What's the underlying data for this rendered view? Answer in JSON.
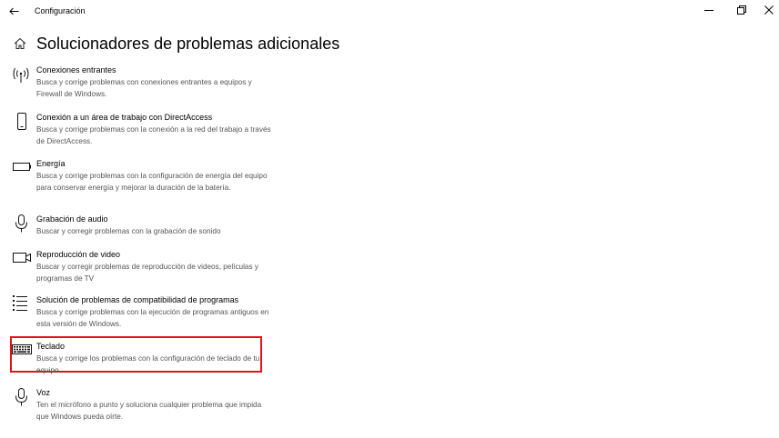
{
  "window": {
    "title": "Configuración"
  },
  "page": {
    "title": "Solucionadores de problemas adicionales"
  },
  "items": [
    {
      "name": "Conexiones entrantes",
      "description": "Busca y corrige problemas con conexiones entrantes a equipos y Firewall de Windows.",
      "icon": "antenna-icon"
    },
    {
      "name": "Conexión a un área de trabajo con DirectAccess",
      "description": "Busca y corrige problemas con la conexión a la red del trabajo a través de DirectAccess.",
      "icon": "phone-icon"
    },
    {
      "name": "Energía",
      "description": "Busca y corrige problemas con la configuración de energía del equipo para conservar energía y mejorar la duración de la batería.",
      "icon": "battery-icon"
    },
    {
      "name": "Grabación de audio",
      "description": "Buscar y corregir problemas con la grabación de sonido",
      "icon": "microphone-icon"
    },
    {
      "name": "Reproducción de video",
      "description": "Buscar y corregir problemas de reproducción de videos, películas y programas de TV",
      "icon": "video-camera-icon"
    },
    {
      "name": "Solución de problemas de compatibilidad de programas",
      "description": "Busca y corrige problemas con la ejecución de programas antiguos en esta versión de Windows.",
      "icon": "list-icon"
    },
    {
      "name": "Teclado",
      "description": "Busca y corrige los problemas con la configuración de teclado de tu equipo.",
      "icon": "keyboard-icon"
    },
    {
      "name": "Voz",
      "description": "Ten el micrófono a punto y soluciona cualquier problema que impida que Windows pueda oírte.",
      "icon": "microphone-icon"
    }
  ],
  "highlight_color": "#e2141b"
}
